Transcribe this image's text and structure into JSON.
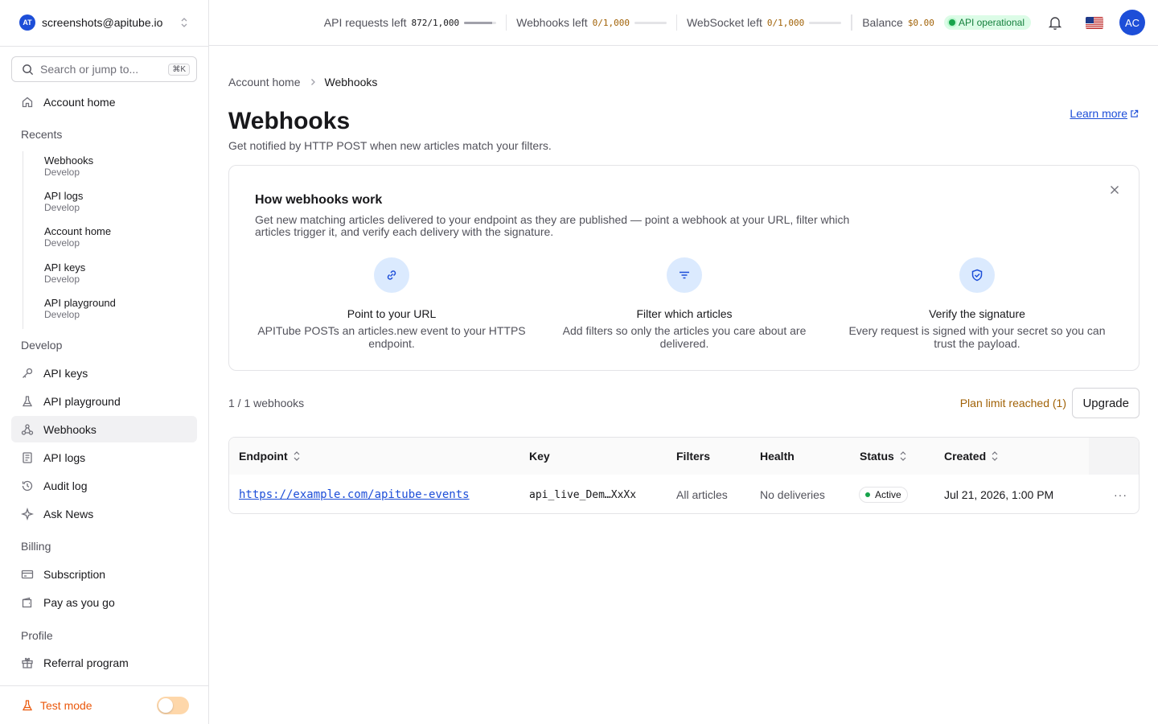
{
  "account": {
    "email": "screenshots@apitube.io",
    "logo_text": "AT"
  },
  "search": {
    "placeholder": "Search or jump to...",
    "shortcut": "⌘K"
  },
  "sidebar": {
    "home_label": "Account home",
    "recents_label": "Recents",
    "recents": [
      {
        "title": "Webhooks",
        "sub": "Develop"
      },
      {
        "title": "API logs",
        "sub": "Develop"
      },
      {
        "title": "Account home",
        "sub": "Develop"
      },
      {
        "title": "API keys",
        "sub": "Develop"
      },
      {
        "title": "API playground",
        "sub": "Develop"
      }
    ],
    "develop_label": "Develop",
    "develop_items": [
      "API keys",
      "API playground",
      "Webhooks",
      "API logs",
      "Audit log",
      "Ask News"
    ],
    "billing_label": "Billing",
    "billing_items": [
      "Subscription",
      "Pay as you go"
    ],
    "profile_label": "Profile",
    "profile_items": [
      "Referral program"
    ],
    "test_mode_label": "Test mode"
  },
  "header": {
    "api_requests_label": "API requests left",
    "api_requests_value": "872/1,000",
    "api_requests_fraction": 0.872,
    "webhooks_label": "Webhooks left",
    "webhooks_value": "0/1,000",
    "webhooks_fraction": 0,
    "websocket_label": "WebSocket left",
    "websocket_value": "0/1,000",
    "websocket_fraction": 0,
    "balance_label": "Balance",
    "balance_value": "$0.00",
    "status_label": "API operational",
    "avatar_initials": "AC"
  },
  "breadcrumb": {
    "parent": "Account home",
    "current": "Webhooks"
  },
  "page": {
    "title": "Webhooks",
    "subtitle": "Get notified by HTTP POST when new articles match your filters.",
    "learn_more": "Learn more"
  },
  "info_card": {
    "title": "How webhooks work",
    "description": "Get new matching articles delivered to your endpoint as they are published — point a webhook at your URL, filter which articles trigger it, and verify each delivery with the signature.",
    "steps": [
      {
        "icon": "link-icon",
        "title": "Point to your URL",
        "desc": "APITube POSTs an articles.new event to your HTTPS endpoint."
      },
      {
        "icon": "filter-icon",
        "title": "Filter which articles",
        "desc": "Add filters so only the articles you care about are delivered."
      },
      {
        "icon": "shield-check-icon",
        "title": "Verify the signature",
        "desc": "Every request is signed with your secret so you can trust the payload."
      }
    ]
  },
  "list": {
    "count_text": "1 / 1 webhooks",
    "plan_limit_text": "Plan limit reached (1)",
    "upgrade_label": "Upgrade"
  },
  "table": {
    "columns": [
      "Endpoint",
      "Key",
      "Filters",
      "Health",
      "Status",
      "Created"
    ],
    "rows": [
      {
        "endpoint": "https://example.com/apitube-events",
        "key": "api_live_Dem…XxXx",
        "filters": "All articles",
        "health": "No deliveries",
        "status": "Active",
        "created": "Jul 21, 2026, 1:00 PM",
        "actions": "···"
      }
    ]
  },
  "colors": {
    "accent": "#1d4ed8",
    "success": "#16a34a",
    "warning": "#a16207",
    "test_mode": "#ea580c"
  }
}
